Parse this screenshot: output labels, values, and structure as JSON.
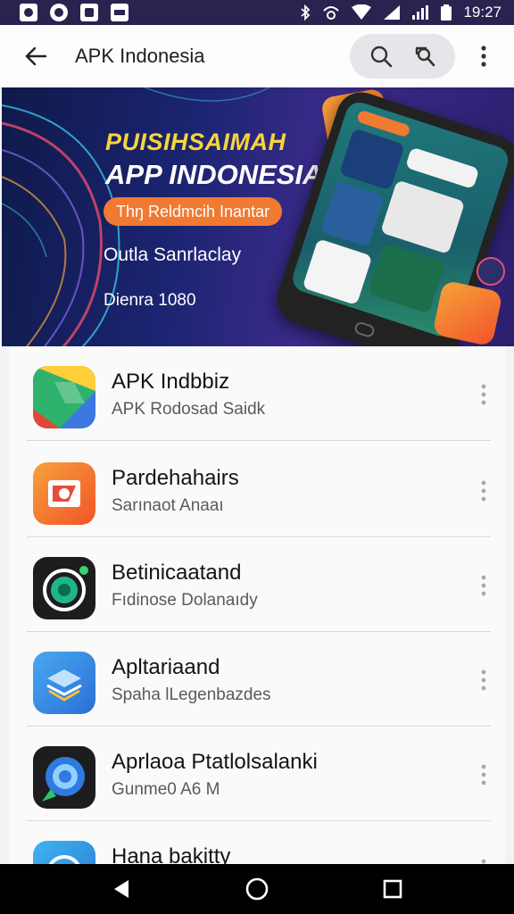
{
  "status_bar": {
    "time": "19:27",
    "left_icons": [
      "app-notification-icon",
      "app-notification-icon",
      "app-notification-icon",
      "app-notification-icon"
    ],
    "right_icons": [
      "bluetooth-icon",
      "wifi-calling-icon",
      "wifi-icon",
      "signal-icon",
      "battery-icon"
    ]
  },
  "app_bar": {
    "title": "APK Indonesia",
    "icons": [
      "back-arrow-icon",
      "search-icon",
      "search-settings-icon",
      "more-vert-icon"
    ]
  },
  "banner": {
    "headline_1": "PUISIHSAIMAH",
    "headline_2": "APP INDONESIA",
    "pill_text": "Thŋ Reldmcih Inantar",
    "subtitle": "Outla Sanrlaclay",
    "subtitle_2": "Dienra 1080",
    "colors": {
      "headline_1": "#f7d53b",
      "pill": "#f07a32",
      "background": "#1b2470"
    }
  },
  "apps": [
    {
      "title": "APK Indbbiz",
      "subtitle": "APK Rodosad Saidk",
      "icon": "drive-style-icon"
    },
    {
      "title": "Pardehahairs",
      "subtitle": "Sarınaot Anaaı",
      "icon": "photo-frame-icon"
    },
    {
      "title": "Betinicaatand",
      "subtitle": "Fıdinose Dolanaıdy",
      "icon": "camera-ring-icon"
    },
    {
      "title": "Apltariaand",
      "subtitle": "Spaha lLegenbazdes",
      "icon": "layers-box-icon"
    },
    {
      "title": "Aprlaoa Ptatlolsalanki",
      "subtitle": "Gunme0 A6 M",
      "icon": "chat-bubble-icon"
    },
    {
      "title": "Hana bakitty",
      "subtitle": "",
      "icon": "circle-app-icon"
    }
  ],
  "nav_bar": {
    "icons": [
      "back-triangle-icon",
      "home-circle-icon",
      "recents-square-icon"
    ]
  }
}
